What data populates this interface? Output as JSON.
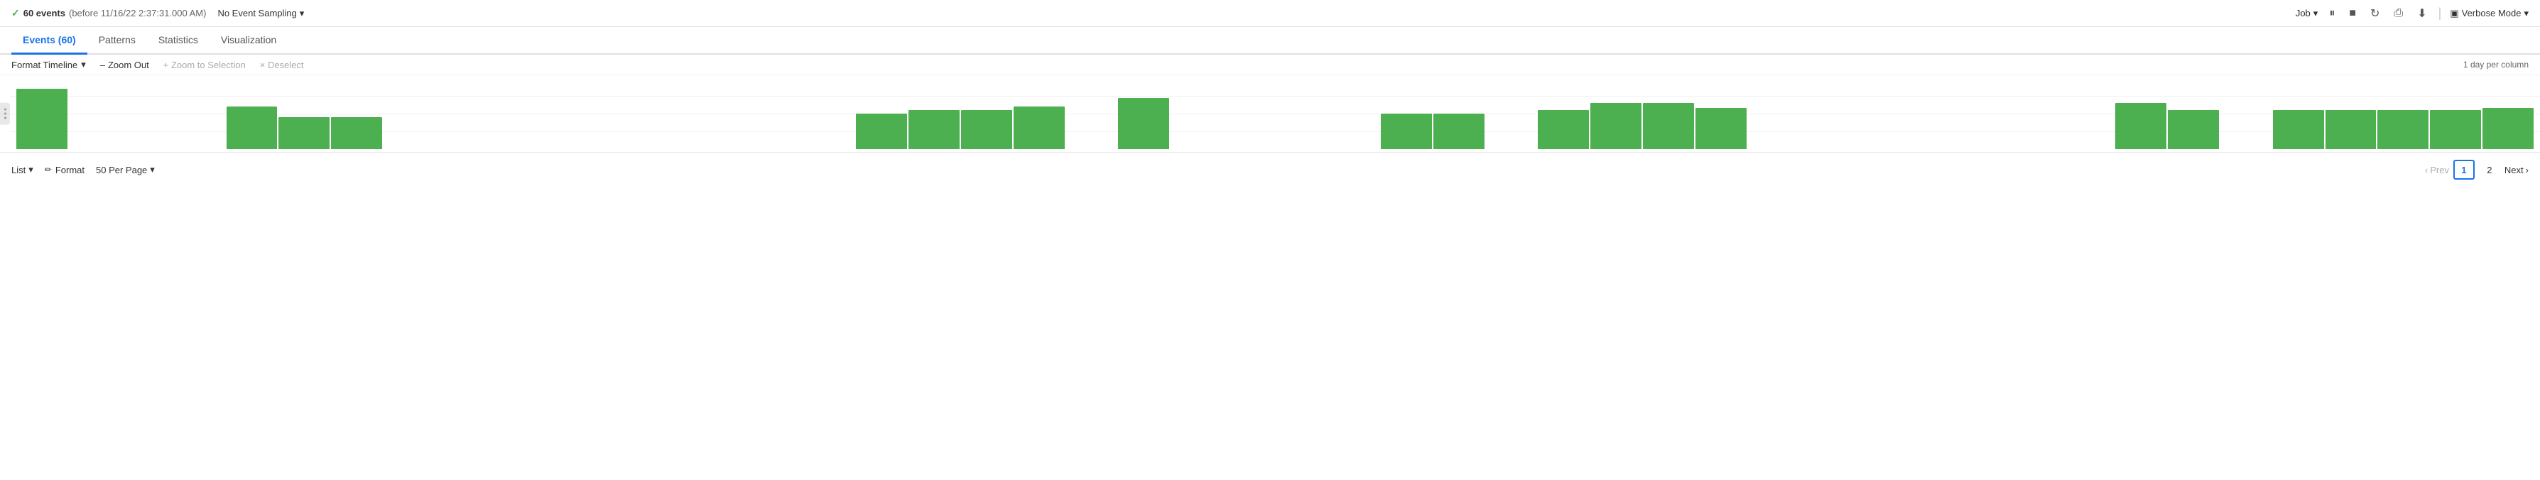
{
  "topBar": {
    "eventsCount": "60 events",
    "eventsMeta": "(before 11/16/22 2:37:31.000 AM)",
    "sampling": "No Event Sampling",
    "job": "Job",
    "verboseMode": "Verbose Mode",
    "checkmark": "✓"
  },
  "tabs": [
    {
      "label": "Events (60)",
      "active": true
    },
    {
      "label": "Patterns",
      "active": false
    },
    {
      "label": "Statistics",
      "active": false
    },
    {
      "label": "Visualization",
      "active": false
    }
  ],
  "timeline": {
    "formatBtn": "Format Timeline",
    "zoomOut": "Zoom Out",
    "zoomSelection": "+ Zoom to Selection",
    "deselect": "× Deselect",
    "perColumn": "1 day per column"
  },
  "bottomBar": {
    "list": "List",
    "format": "Format",
    "perPage": "50 Per Page"
  },
  "pagination": {
    "prev": "< Prev",
    "page1": "1",
    "page2": "2",
    "next": "Next >"
  },
  "chart": {
    "bars": [
      {
        "height": 85
      },
      {
        "height": 0
      },
      {
        "height": 0
      },
      {
        "height": 0
      },
      {
        "height": 60
      },
      {
        "height": 45
      },
      {
        "height": 45
      },
      {
        "height": 0
      },
      {
        "height": 0
      },
      {
        "height": 0
      },
      {
        "height": 0
      },
      {
        "height": 0
      },
      {
        "height": 0
      },
      {
        "height": 0
      },
      {
        "height": 0
      },
      {
        "height": 0
      },
      {
        "height": 50
      },
      {
        "height": 55
      },
      {
        "height": 55
      },
      {
        "height": 60
      },
      {
        "height": 0
      },
      {
        "height": 72
      },
      {
        "height": 0
      },
      {
        "height": 0
      },
      {
        "height": 0
      },
      {
        "height": 0
      },
      {
        "height": 50
      },
      {
        "height": 50
      },
      {
        "height": 0
      },
      {
        "height": 55
      },
      {
        "height": 65
      },
      {
        "height": 65
      },
      {
        "height": 58
      },
      {
        "height": 0
      },
      {
        "height": 0
      },
      {
        "height": 0
      },
      {
        "height": 0
      },
      {
        "height": 0
      },
      {
        "height": 0
      },
      {
        "height": 0
      },
      {
        "height": 65
      },
      {
        "height": 55
      },
      {
        "height": 0
      },
      {
        "height": 55
      },
      {
        "height": 55
      },
      {
        "height": 55
      },
      {
        "height": 55
      },
      {
        "height": 58
      }
    ]
  },
  "icons": {
    "checkmark": "✓",
    "caretDown": "▾",
    "pause": "⏸",
    "stop": "■",
    "redo": "↻",
    "print": "⎙",
    "download": "⬇",
    "monitor": "▣",
    "chevronLeft": "‹",
    "chevronRight": "›",
    "minus": "–",
    "plus": "+",
    "times": "×",
    "pencil": "✏"
  }
}
